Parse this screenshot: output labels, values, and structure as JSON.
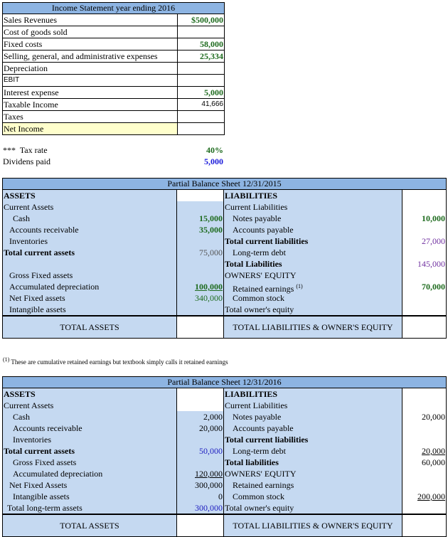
{
  "income_statement": {
    "title": "Income Statement year ending 2016",
    "rows": [
      {
        "label": "Sales Revenues",
        "value": "$500,000"
      },
      {
        "label": "Cost of goods sold",
        "value": ""
      },
      {
        "label": "Fixed costs",
        "value": "58,000"
      },
      {
        "label": "Selling, general, and administrative expenses",
        "value": "25,334"
      },
      {
        "label": "Depreciation",
        "value": ""
      },
      {
        "label": "EBIT",
        "value": ""
      },
      {
        "label": "Interest expense",
        "value": "5,000"
      },
      {
        "label": "Taxable Income",
        "value": "41,666"
      },
      {
        "label": "Taxes",
        "value": ""
      },
      {
        "label": "Net Income",
        "value": ""
      }
    ]
  },
  "assumptions": {
    "tax_rate_label": "***  Tax rate",
    "tax_rate_value": "40%",
    "dividends_label": "Dividens paid",
    "dividends_value": "5,000"
  },
  "balance_2015": {
    "title": "Partial Balance Sheet 12/31/2015",
    "assets": [
      {
        "label": "ASSETS",
        "value": ""
      },
      {
        "label": "Current Assets",
        "value": ""
      },
      {
        "label": "Cash",
        "value": "15,000"
      },
      {
        "label": "Accounts receivable",
        "value": "35,000"
      },
      {
        "label": "Inventories",
        "value": ""
      },
      {
        "label": "Total current assets",
        "value": "75,000"
      },
      {
        "label": "",
        "value": ""
      },
      {
        "label": "Gross Fixed assets",
        "value": ""
      },
      {
        "label": "Accumulated depreciation",
        "value": "100,000"
      },
      {
        "label": "Net Fixed assets",
        "value": "340,000"
      },
      {
        "label": "Intangible assets",
        "value": ""
      }
    ],
    "liabilities": [
      {
        "label": "LIABILITIES",
        "value": ""
      },
      {
        "label": "Current Liabilities",
        "value": ""
      },
      {
        "label": "Notes payable",
        "value": "10,000"
      },
      {
        "label": "Accounts payable",
        "value": ""
      },
      {
        "label": "Total current liabilities",
        "value": "27,000"
      },
      {
        "label": "Long-term debt",
        "value": ""
      },
      {
        "label": "Total Liabilities",
        "value": "145,000"
      },
      {
        "label": "OWNERS' EQUITY",
        "value": ""
      },
      {
        "label": "Retained earnings",
        "note": "(1)",
        "value": "70,000"
      },
      {
        "label": "Common stock",
        "value": ""
      },
      {
        "label": "Total owner's equity",
        "value": ""
      }
    ],
    "total_assets_label": "TOTAL ASSETS",
    "total_liab_label": "TOTAL LIABILITIES & OWNER'S EQUITY"
  },
  "footnote": {
    "marker": "(1)",
    "text": "These are cumulative retained earnings but textbook simply calls it retained earnings"
  },
  "balance_2016": {
    "title": "Partial Balance Sheet 12/31/2016",
    "assets": [
      {
        "label": "ASSETS",
        "value": ""
      },
      {
        "label": "Current Assets",
        "value": ""
      },
      {
        "label": "Cash",
        "value": "2,000"
      },
      {
        "label": "Accounts receivable",
        "value": "20,000"
      },
      {
        "label": "Inventories",
        "value": ""
      },
      {
        "label": "Total current assets",
        "value": "50,000"
      },
      {
        "label": "Gross Fixed assets",
        "value": ""
      },
      {
        "label": "Accumulated depreciation",
        "value": "120,000"
      },
      {
        "label": "Net Fixed Assets",
        "value": "300,000"
      },
      {
        "label": "Intangible assets",
        "value": "0"
      },
      {
        "label": "Total long-term assets",
        "value": "300,000"
      }
    ],
    "liabilities": [
      {
        "label": "LIABILITIES",
        "value": ""
      },
      {
        "label": "Current Liabilities",
        "value": ""
      },
      {
        "label": "Notes payable",
        "value": "20,000"
      },
      {
        "label": "Accounts payable",
        "value": ""
      },
      {
        "label": "Total current liabilities",
        "value": ""
      },
      {
        "label": "Long-term debt",
        "value": "20,000"
      },
      {
        "label": "Total liabilities",
        "value": "60,000"
      },
      {
        "label": "OWNERS' EQUITY",
        "value": ""
      },
      {
        "label": "Retained earnings",
        "value": ""
      },
      {
        "label": "Common stock",
        "value": "200,000"
      },
      {
        "label": "Total owner's equity",
        "value": ""
      }
    ],
    "total_assets_label": "TOTAL ASSETS",
    "total_liab_label": "TOTAL LIABILITIES & OWNER'S EQUITY"
  },
  "colors": {
    "header_blue": "#8db4e2",
    "panel_blue": "#c5d9f1",
    "highlight_yellow": "#ffffcc",
    "input_green": "#1e6b1e",
    "input_blue": "#1a1adb",
    "calc_purple": "#7030a0"
  }
}
